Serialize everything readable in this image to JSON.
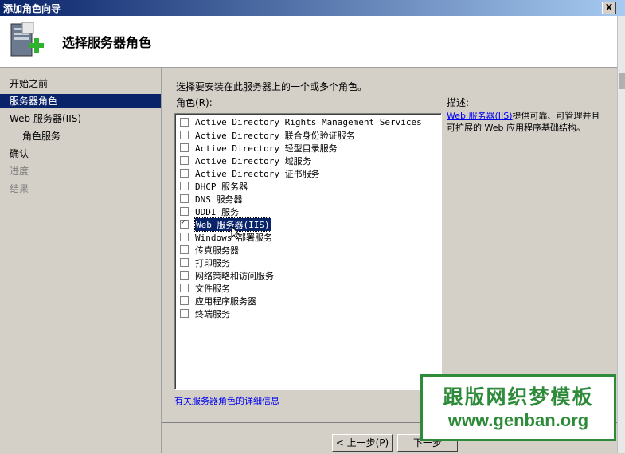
{
  "window": {
    "title": "添加角色向导",
    "close_glyph": "X"
  },
  "header": {
    "title": "选择服务器角色"
  },
  "nav": {
    "items": [
      {
        "label": "开始之前",
        "state": "normal"
      },
      {
        "label": "服务器角色",
        "state": "active"
      },
      {
        "label": "Web 服务器(IIS)",
        "state": "normal"
      },
      {
        "label": "角色服务",
        "state": "sub"
      },
      {
        "label": "确认",
        "state": "normal"
      },
      {
        "label": "进度",
        "state": "disabled"
      },
      {
        "label": "结果",
        "state": "disabled"
      }
    ]
  },
  "main": {
    "instruction": "选择要安装在此服务器上的一个或多个角色。",
    "roles_label": "角色(R):",
    "roles": [
      {
        "label": "Active Directory Rights Management Services",
        "checked": false
      },
      {
        "label": "Active Directory 联合身份验证服务",
        "checked": false
      },
      {
        "label": "Active Directory 轻型目录服务",
        "checked": false
      },
      {
        "label": "Active Directory 域服务",
        "checked": false
      },
      {
        "label": "Active Directory 证书服务",
        "checked": false
      },
      {
        "label": "DHCP 服务器",
        "checked": false
      },
      {
        "label": "DNS 服务器",
        "checked": false
      },
      {
        "label": "UDDI 服务",
        "checked": false
      },
      {
        "label": "Web 服务器(IIS)",
        "checked": true,
        "selected": true
      },
      {
        "label": "Windows 部署服务",
        "checked": false
      },
      {
        "label": "传真服务器",
        "checked": false
      },
      {
        "label": "打印服务",
        "checked": false
      },
      {
        "label": "网络策略和访问服务",
        "checked": false
      },
      {
        "label": "文件服务",
        "checked": false
      },
      {
        "label": "应用程序服务器",
        "checked": false
      },
      {
        "label": "终端服务",
        "checked": false
      }
    ],
    "description_label": "描述:",
    "description_link": "Web 服务器(IIS)",
    "description_text": "提供可靠、可管理并且可扩展的 Web 应用程序基础结构。",
    "more_info_link": "有关服务器角色的详细信息"
  },
  "buttons": {
    "previous": "< 上一步(P)",
    "next": "下一步"
  },
  "watermark": {
    "line1": "跟版网织梦模板",
    "line2": "www.genban.org"
  },
  "colors": {
    "accent": "#0a246a",
    "watermark": "#2e8b3a",
    "link": "#0000ee"
  }
}
